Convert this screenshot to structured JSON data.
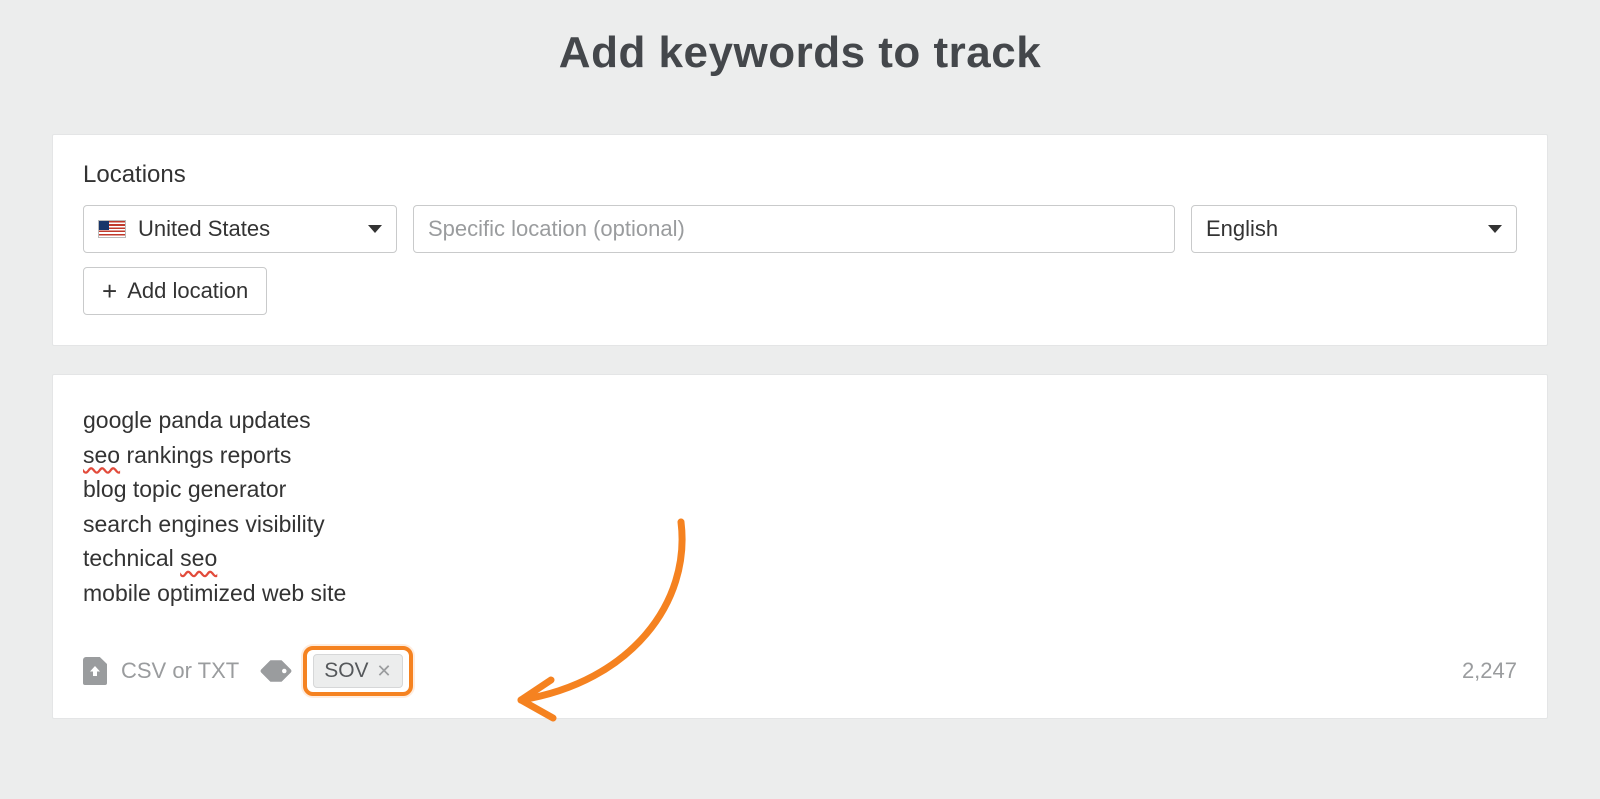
{
  "page": {
    "title": "Add keywords to track"
  },
  "locations": {
    "label": "Locations",
    "country": "United States",
    "specific_placeholder": "Specific location (optional)",
    "language": "English",
    "add_button": "Add location"
  },
  "keywords": {
    "lines": [
      {
        "pre": "google panda updates",
        "spell": "",
        "post": ""
      },
      {
        "pre": "",
        "spell": "seo",
        "post": " rankings reports"
      },
      {
        "pre": "blog topic generator",
        "spell": "",
        "post": ""
      },
      {
        "pre": "search engines visibility",
        "spell": "",
        "post": ""
      },
      {
        "pre": "technical ",
        "spell": "seo",
        "post": ""
      },
      {
        "pre": "mobile optimized web site",
        "spell": "",
        "post": ""
      }
    ]
  },
  "footer": {
    "upload_label": "CSV or TXT",
    "tag": "SOV",
    "count": "2,247"
  }
}
